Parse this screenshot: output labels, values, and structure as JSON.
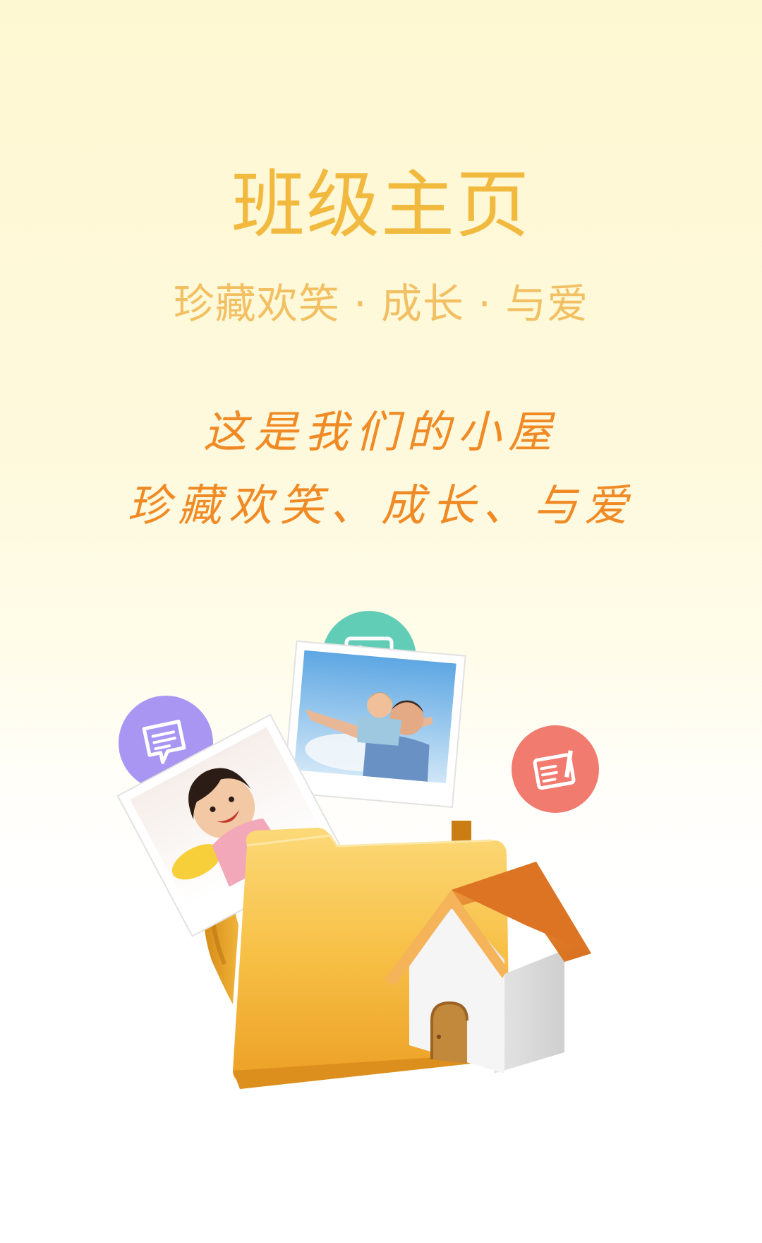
{
  "header": {
    "title": "班级主页",
    "subtitle": "珍藏欢笑 · 成长 · 与爱"
  },
  "slogan": {
    "line1": "这是我们的小屋",
    "line2": "珍藏欢笑、成长、与爱"
  },
  "icons": {
    "image": "image-icon",
    "message": "message-icon",
    "note": "note-edit-icon",
    "folder": "folder-icon",
    "house": "house-icon"
  },
  "colors": {
    "title": "#f2b93f",
    "subtitle": "#f2c063",
    "script": "#f08a25",
    "bubble_image": "#62cdb7",
    "bubble_message": "#a996f3",
    "bubble_note": "#f27b70",
    "folder": "#f5b42e",
    "roof": "#e17a24"
  }
}
